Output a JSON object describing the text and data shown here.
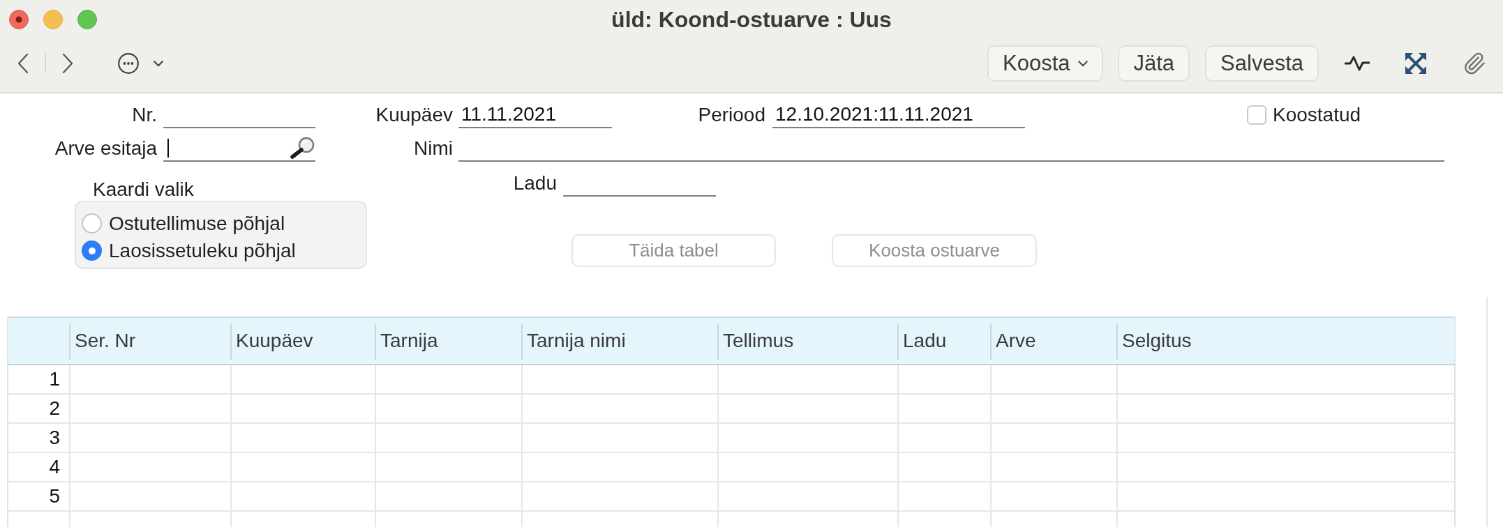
{
  "window": {
    "title": "üld: Koond-ostuarve : Uus",
    "unsaved": true
  },
  "toolbar": {
    "buttons": [
      {
        "label": "Koosta",
        "kind": "menu"
      },
      {
        "label": "Jäta",
        "kind": "plain"
      },
      {
        "label": "Salvesta",
        "kind": "plain"
      }
    ]
  },
  "form": {
    "nr": {
      "label": "Nr."
    },
    "date": {
      "label": "Kuupäev",
      "value": "11.11.2021"
    },
    "period": {
      "label": "Periood",
      "value": "12.10.2021:11.11.2021"
    },
    "compiled": {
      "label": "Koostatud",
      "checked": false
    },
    "invoice_issuer": {
      "label": "Arve esitaja",
      "focused": true
    },
    "name": {
      "label": "Nimi"
    },
    "card_choice": {
      "label": "Kaardi valik",
      "options": [
        {
          "label": "Ostutellimuse põhjal",
          "selected": false
        },
        {
          "label": "Laosissetuleku põhjal",
          "selected": true
        }
      ]
    },
    "warehouse": {
      "label": "Ladu"
    },
    "actions": [
      {
        "label": "Täida tabel",
        "disabled": true
      },
      {
        "label": "Koosta ostuarve",
        "disabled": true
      }
    ]
  },
  "table": {
    "columns": [
      "Ser. Nr",
      "Kuupäev",
      "Tarnija",
      "Tarnija nimi",
      "Tellimus",
      "Ladu",
      "Arve",
      "Selgitus"
    ],
    "rows": [
      {
        "number": "1"
      },
      {
        "number": "2"
      },
      {
        "number": "3"
      },
      {
        "number": "4"
      },
      {
        "number": "5"
      }
    ]
  }
}
